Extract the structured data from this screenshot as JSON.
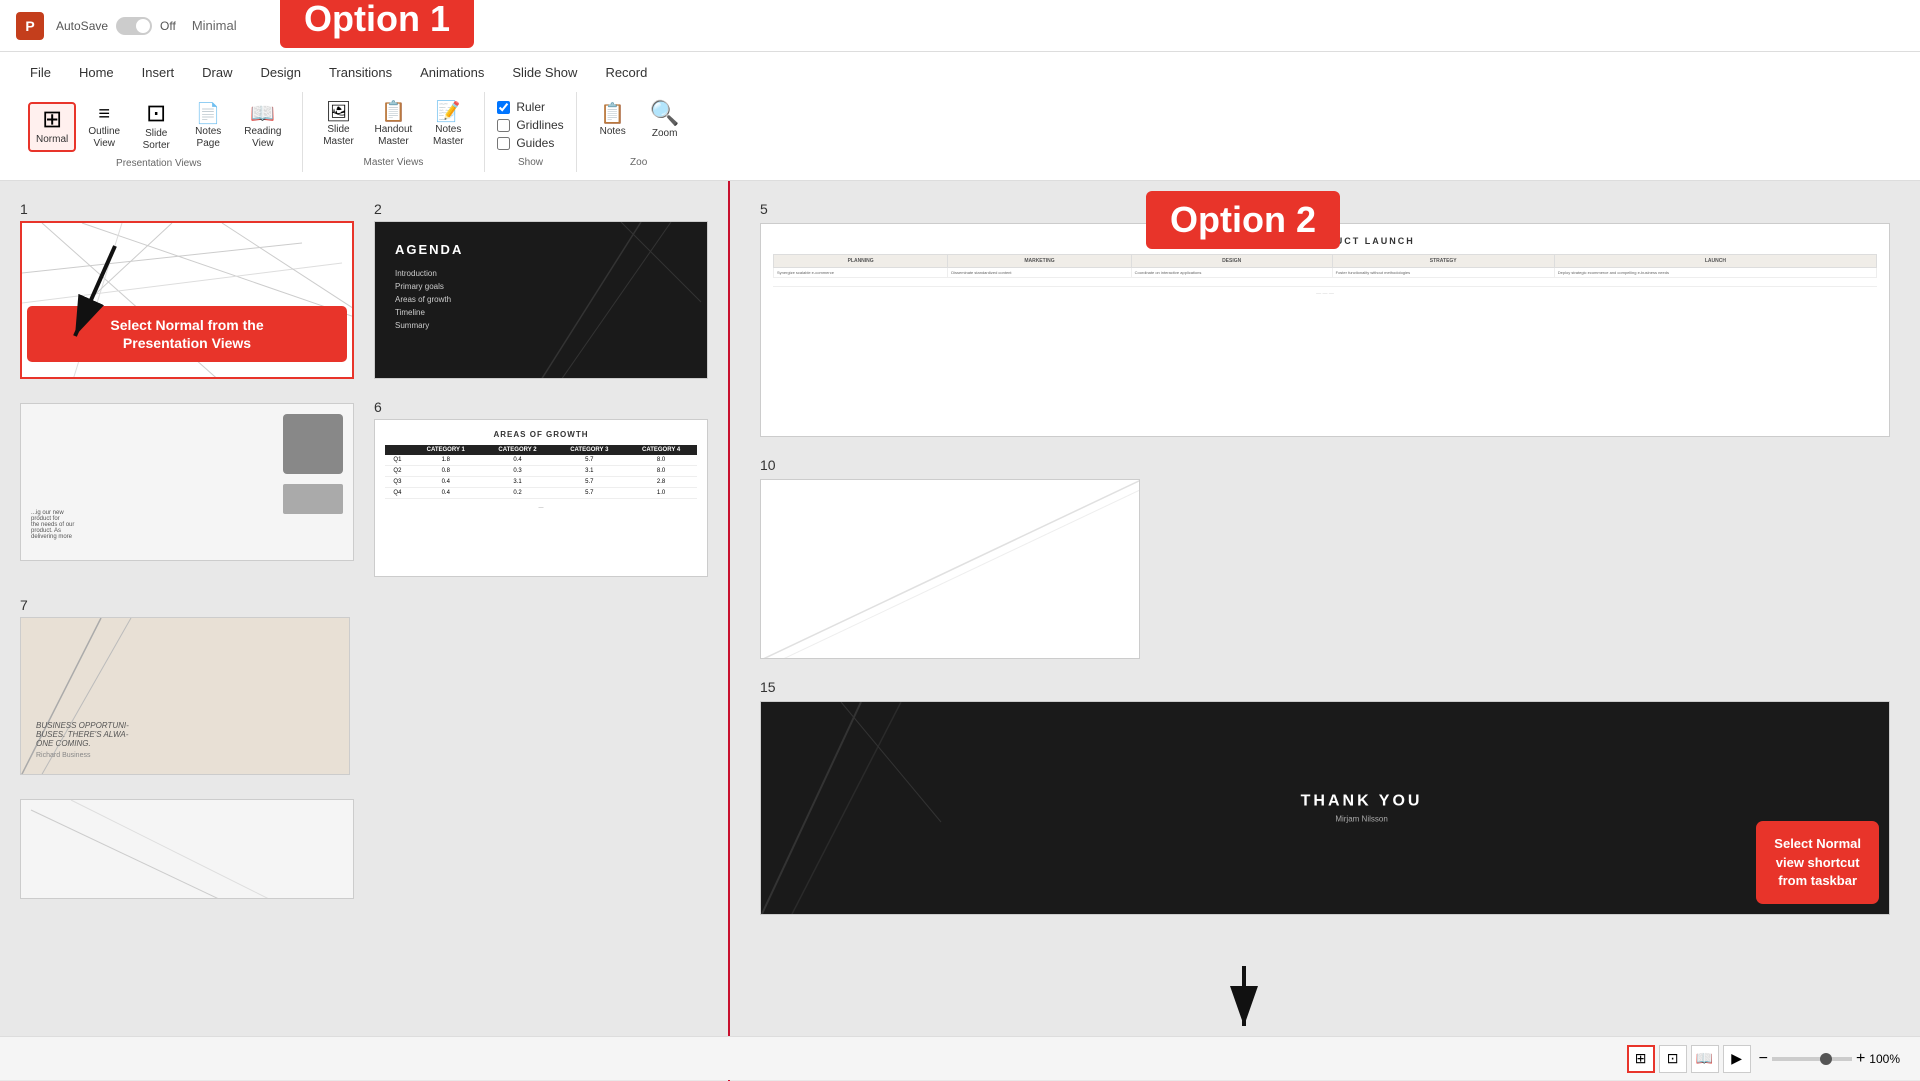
{
  "app": {
    "logo": "P",
    "autosave_label": "AutoSave",
    "autosave_state": "Off",
    "title": "Minimal"
  },
  "option1": {
    "label": "Option 1"
  },
  "option2": {
    "label": "Option 2"
  },
  "ribbon": {
    "tabs": [
      "File",
      "Home",
      "Insert",
      "Draw",
      "Design",
      "Transitions",
      "Animations",
      "Slide Show",
      "Record"
    ],
    "groups": {
      "presentation_views": {
        "label": "Presentation Views",
        "buttons": [
          {
            "id": "normal",
            "icon": "⊞",
            "label": "Normal",
            "active": true
          },
          {
            "id": "outline",
            "icon": "≡",
            "label": "Outline\nView",
            "active": false
          },
          {
            "id": "slide_sorter",
            "icon": "⊡",
            "label": "Slide\nSorter",
            "active": false
          },
          {
            "id": "notes_page",
            "icon": "📄",
            "label": "Notes\nPage",
            "active": false
          },
          {
            "id": "reading_view",
            "icon": "📖",
            "label": "Reading\nView",
            "active": false
          }
        ]
      },
      "master_views": {
        "label": "Master Views",
        "buttons": [
          {
            "id": "slide_master",
            "icon": "🖼",
            "label": "Slide\nMaster",
            "active": false
          },
          {
            "id": "handout_master",
            "icon": "📋",
            "label": "Handout\nMaster",
            "active": false
          },
          {
            "id": "notes_master",
            "icon": "📝",
            "label": "Notes\nMaster",
            "active": false
          }
        ]
      },
      "show": {
        "label": "Show",
        "items": [
          "Ruler",
          "Gridlines",
          "Guides"
        ]
      },
      "zoom": {
        "label": "Zoo",
        "buttons": [
          {
            "id": "notes_btn",
            "icon": "📋",
            "label": "Notes"
          },
          {
            "id": "zoom_btn",
            "icon": "🔍",
            "label": "Zoom"
          }
        ]
      }
    }
  },
  "slides": {
    "left": [
      {
        "num": "1",
        "type": "geometric_white",
        "selected": true,
        "callout": "Select Normal from the\nPresentation Views"
      },
      {
        "num": "2",
        "type": "agenda_dark",
        "title": "AGENDA",
        "items": [
          "Introduction",
          "Primary goals",
          "Areas of growth",
          "Timeline",
          "Summary"
        ]
      },
      {
        "num": "",
        "type": "person_white"
      },
      {
        "num": "6",
        "type": "data_table",
        "title": "AREAS OF GROWTH",
        "headers": [
          "CATEGORY 1",
          "CATEGORY 2",
          "CATEGORY 3",
          "CATEGORY 4"
        ],
        "rows": [
          [
            "Q1",
            "1.8",
            "0.4",
            "5.7",
            "8.0"
          ],
          [
            "Q2",
            "0.8",
            "0.3",
            "3.1",
            "8.0"
          ],
          [
            "Q3",
            "0.4",
            "3.1",
            "5.7",
            "2.8"
          ],
          [
            "Q4",
            "0.4",
            "0.2",
            "5.7",
            "1.0"
          ]
        ]
      },
      {
        "num": "7",
        "type": "beige",
        "text": "BUSINESS OPPORTUNI-\nBUSES. THERE'S ALWA-\nONE COMING.",
        "author": "Richard Business"
      }
    ],
    "right": [
      {
        "num": "5",
        "type": "product_launch",
        "title": "PLAN FOR PRODUCT LAUNCH",
        "headers": [
          "PLANNING",
          "MARKETING",
          "DESIGN",
          "STRATEGY",
          "LAUNCH"
        ],
        "rows": [
          [
            "Synergize scalable e-commerce",
            "Disseminate standardized content",
            "Coordinate on interactive applications",
            "Foster functionality without methodologies",
            "Deploy strategic ecommerce and compelling e-business needs"
          ]
        ]
      },
      {
        "num": "10",
        "type": "white_plain"
      },
      {
        "num": "15",
        "type": "thankyou_dark",
        "title": "THANK YOU",
        "name": "Mirjam Nilsson",
        "callout": "Select Normal\nview shortcut\nfrom taskbar"
      }
    ]
  },
  "taskbar": {
    "buttons": [
      {
        "id": "normal_view",
        "icon": "⊞",
        "active": true
      },
      {
        "id": "slide_sorter_view",
        "icon": "⊡",
        "active": false
      },
      {
        "id": "reading_view",
        "icon": "📖",
        "active": false
      },
      {
        "id": "slideshow_view",
        "icon": "▶",
        "active": false
      }
    ],
    "zoom_minus": "−",
    "zoom_plus": "+",
    "zoom_percent": "100%"
  }
}
